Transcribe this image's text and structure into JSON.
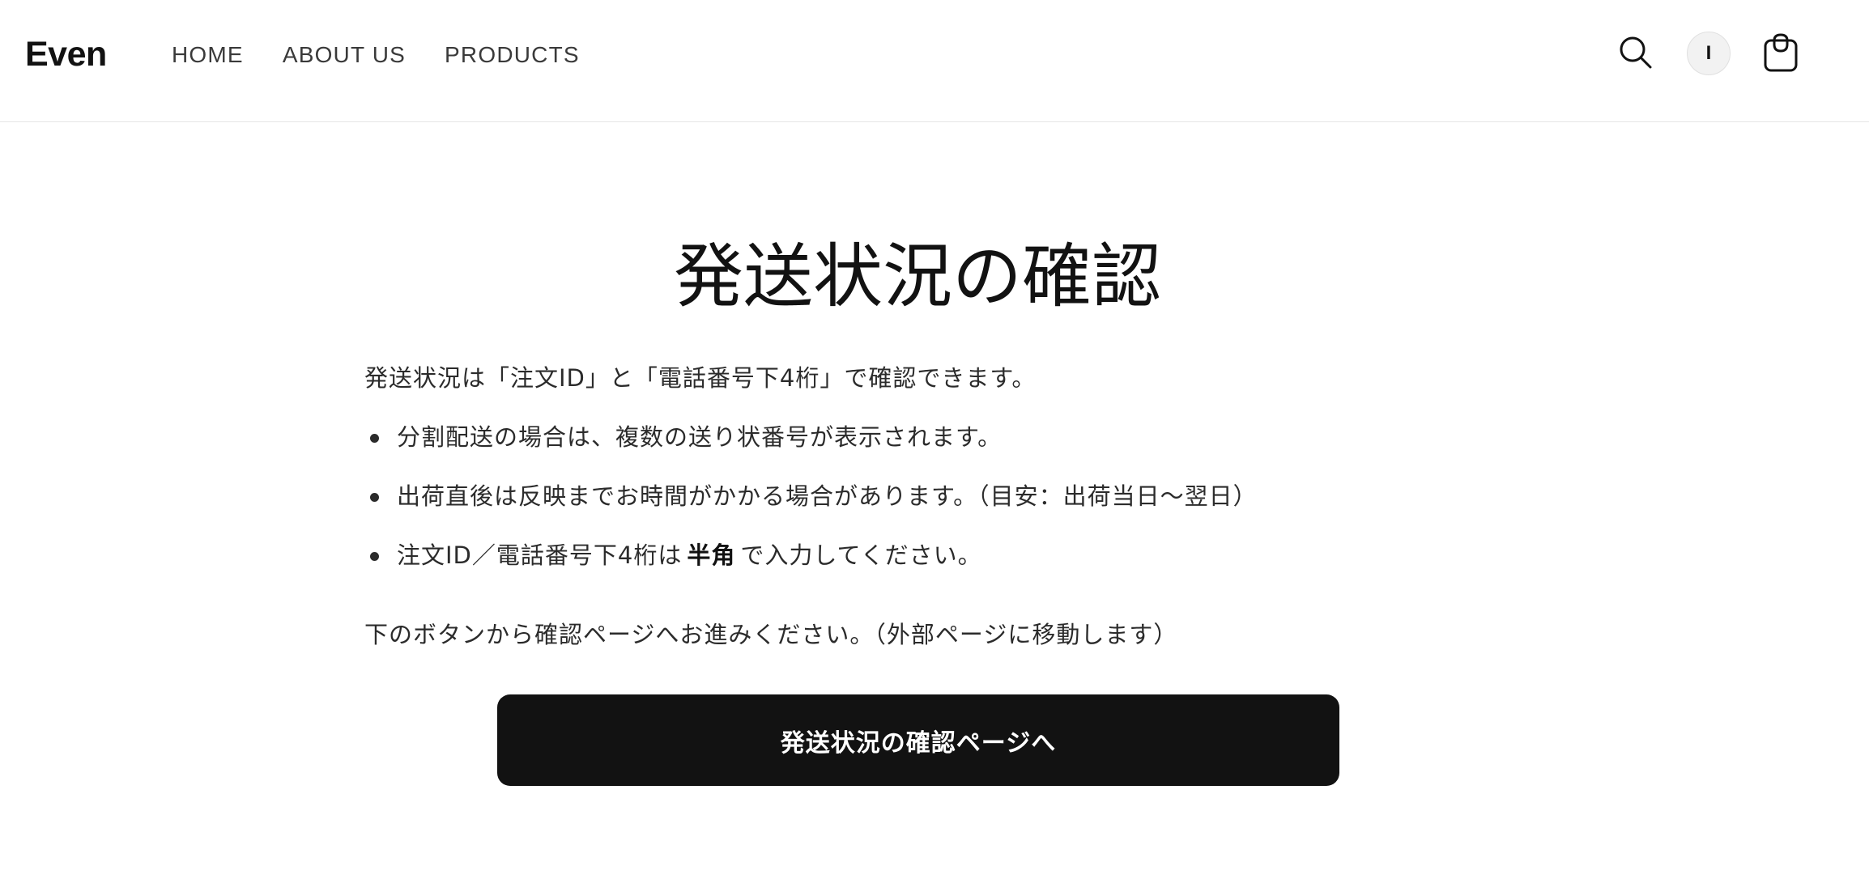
{
  "header": {
    "logo": "Even",
    "nav": [
      {
        "label": "HOME"
      },
      {
        "label": "ABOUT US"
      },
      {
        "label": "PRODUCTS"
      }
    ],
    "icons": {
      "search": "search-icon",
      "account_initial": "I",
      "cart": "cart-icon"
    }
  },
  "main": {
    "title": "発送状況の確認",
    "intro": "発送状況は「注文ID」と「電話番号下4桁」で確認できます。",
    "bullets": {
      "item1": "分割配送の場合は、複数の送り状番号が表示されます。",
      "item2": "出荷直後は反映までお時間がかかる場合があります。（目安：出荷当日〜翌日）",
      "item3_before": "注文ID／電話番号下4桁は",
      "item3_bold": "半角",
      "item3_after": "で入力してください。"
    },
    "outro": "下のボタンから確認ページへお進みください。（外部ページに移動します）",
    "button_label": "発送状況の確認ページへ"
  },
  "colors": {
    "text": "#121212",
    "button_bg": "#121212",
    "button_text": "#ffffff",
    "divider": "#e6e6e6"
  }
}
